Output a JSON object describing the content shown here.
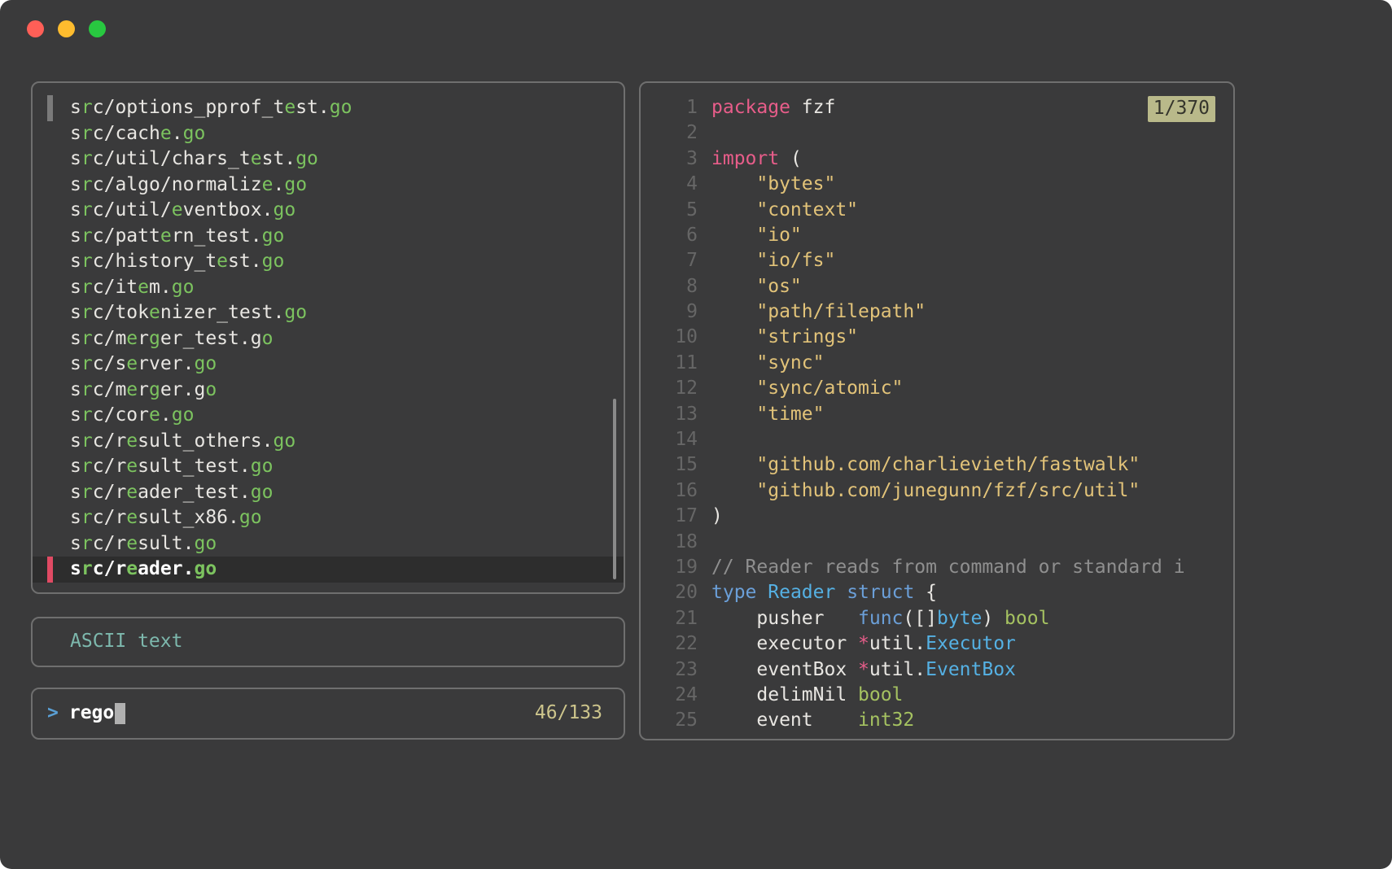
{
  "colors": {
    "page-bg": "#ffffff",
    "window-bg": "#3a3a3b",
    "panel-border": "#6f6f6f",
    "text": "#e8e6e2",
    "text-dim": "#666666",
    "comment": "#8f8f8f",
    "keyword": "#e85d8a",
    "string": "#e2c379",
    "keyword2": "#6b9fd8",
    "type": "#55b1e4",
    "green": "#a5c261",
    "match": "#7cc35f",
    "selected-bg": "#2d2d2d",
    "pointer": "#e04a63",
    "top-marker": "#7a7a7a",
    "scrollbar": "#8a8a8a",
    "info-text": "#7db8ad",
    "counter": "#cdc58c",
    "badge-bg": "#b9b98a",
    "badge-text": "#35352c",
    "prompt": "#5a9fd4",
    "cursor": "#b0b0b0",
    "light-red": "#ff5f57",
    "light-yellow": "#febc2e",
    "light-green": "#28c840"
  },
  "finder": {
    "prompt": ">",
    "query": "rego",
    "counter": "46/133",
    "info": "ASCII text",
    "selected_index": 18,
    "files": [
      "src/options_pprof_test.go",
      "src/cache.go",
      "src/util/chars_test.go",
      "src/algo/normalize.go",
      "src/util/eventbox.go",
      "src/pattern_test.go",
      "src/history_test.go",
      "src/item.go",
      "src/tokenizer_test.go",
      "src/merger_test.go",
      "src/server.go",
      "src/merger.go",
      "src/core.go",
      "src/result_others.go",
      "src/result_test.go",
      "src/reader_test.go",
      "src/result_x86.go",
      "src/result.go",
      "src/reader.go"
    ]
  },
  "preview": {
    "badge": "1/370",
    "lines": [
      {
        "n": 1,
        "t": [
          [
            "kw",
            "package"
          ],
          [
            "pl",
            " fzf"
          ]
        ]
      },
      {
        "n": 2,
        "t": []
      },
      {
        "n": 3,
        "t": [
          [
            "kw",
            "import"
          ],
          [
            "pl",
            " ("
          ]
        ]
      },
      {
        "n": 4,
        "t": [
          [
            "pl",
            "    "
          ],
          [
            "str",
            "\"bytes\""
          ]
        ]
      },
      {
        "n": 5,
        "t": [
          [
            "pl",
            "    "
          ],
          [
            "str",
            "\"context\""
          ]
        ]
      },
      {
        "n": 6,
        "t": [
          [
            "pl",
            "    "
          ],
          [
            "str",
            "\"io\""
          ]
        ]
      },
      {
        "n": 7,
        "t": [
          [
            "pl",
            "    "
          ],
          [
            "str",
            "\"io/fs\""
          ]
        ]
      },
      {
        "n": 8,
        "t": [
          [
            "pl",
            "    "
          ],
          [
            "str",
            "\"os\""
          ]
        ]
      },
      {
        "n": 9,
        "t": [
          [
            "pl",
            "    "
          ],
          [
            "str",
            "\"path/filepath\""
          ]
        ]
      },
      {
        "n": 10,
        "t": [
          [
            "pl",
            "    "
          ],
          [
            "str",
            "\"strings\""
          ]
        ]
      },
      {
        "n": 11,
        "t": [
          [
            "pl",
            "    "
          ],
          [
            "str",
            "\"sync\""
          ]
        ]
      },
      {
        "n": 12,
        "t": [
          [
            "pl",
            "    "
          ],
          [
            "str",
            "\"sync/atomic\""
          ]
        ]
      },
      {
        "n": 13,
        "t": [
          [
            "pl",
            "    "
          ],
          [
            "str",
            "\"time\""
          ]
        ]
      },
      {
        "n": 14,
        "t": []
      },
      {
        "n": 15,
        "t": [
          [
            "pl",
            "    "
          ],
          [
            "str",
            "\"github.com/charlievieth/fastwalk\""
          ]
        ]
      },
      {
        "n": 16,
        "t": [
          [
            "pl",
            "    "
          ],
          [
            "str",
            "\"github.com/junegunn/fzf/src/util\""
          ]
        ]
      },
      {
        "n": 17,
        "t": [
          [
            "pl",
            ")"
          ]
        ]
      },
      {
        "n": 18,
        "t": []
      },
      {
        "n": 19,
        "t": [
          [
            "cm",
            "// Reader reads from command or standard i"
          ]
        ]
      },
      {
        "n": 20,
        "t": [
          [
            "kw2",
            "type"
          ],
          [
            "pl",
            " "
          ],
          [
            "typ",
            "Reader"
          ],
          [
            "pl",
            " "
          ],
          [
            "kw2",
            "struct"
          ],
          [
            "pl",
            " {"
          ]
        ]
      },
      {
        "n": 21,
        "t": [
          [
            "pl",
            "    pusher   "
          ],
          [
            "kw2",
            "func"
          ],
          [
            "pl",
            "([]"
          ],
          [
            "typ",
            "byte"
          ],
          [
            "pl",
            ") "
          ],
          [
            "grn",
            "bool"
          ]
        ]
      },
      {
        "n": 22,
        "t": [
          [
            "pl",
            "    executor "
          ],
          [
            "op",
            "*"
          ],
          [
            "pl",
            "util."
          ],
          [
            "typ",
            "Executor"
          ]
        ]
      },
      {
        "n": 23,
        "t": [
          [
            "pl",
            "    eventBox "
          ],
          [
            "op",
            "*"
          ],
          [
            "pl",
            "util."
          ],
          [
            "typ",
            "EventBox"
          ]
        ]
      },
      {
        "n": 24,
        "t": [
          [
            "pl",
            "    delimNil "
          ],
          [
            "grn",
            "bool"
          ]
        ]
      },
      {
        "n": 25,
        "t": [
          [
            "pl",
            "    event    "
          ],
          [
            "grn",
            "int32"
          ]
        ]
      }
    ]
  }
}
